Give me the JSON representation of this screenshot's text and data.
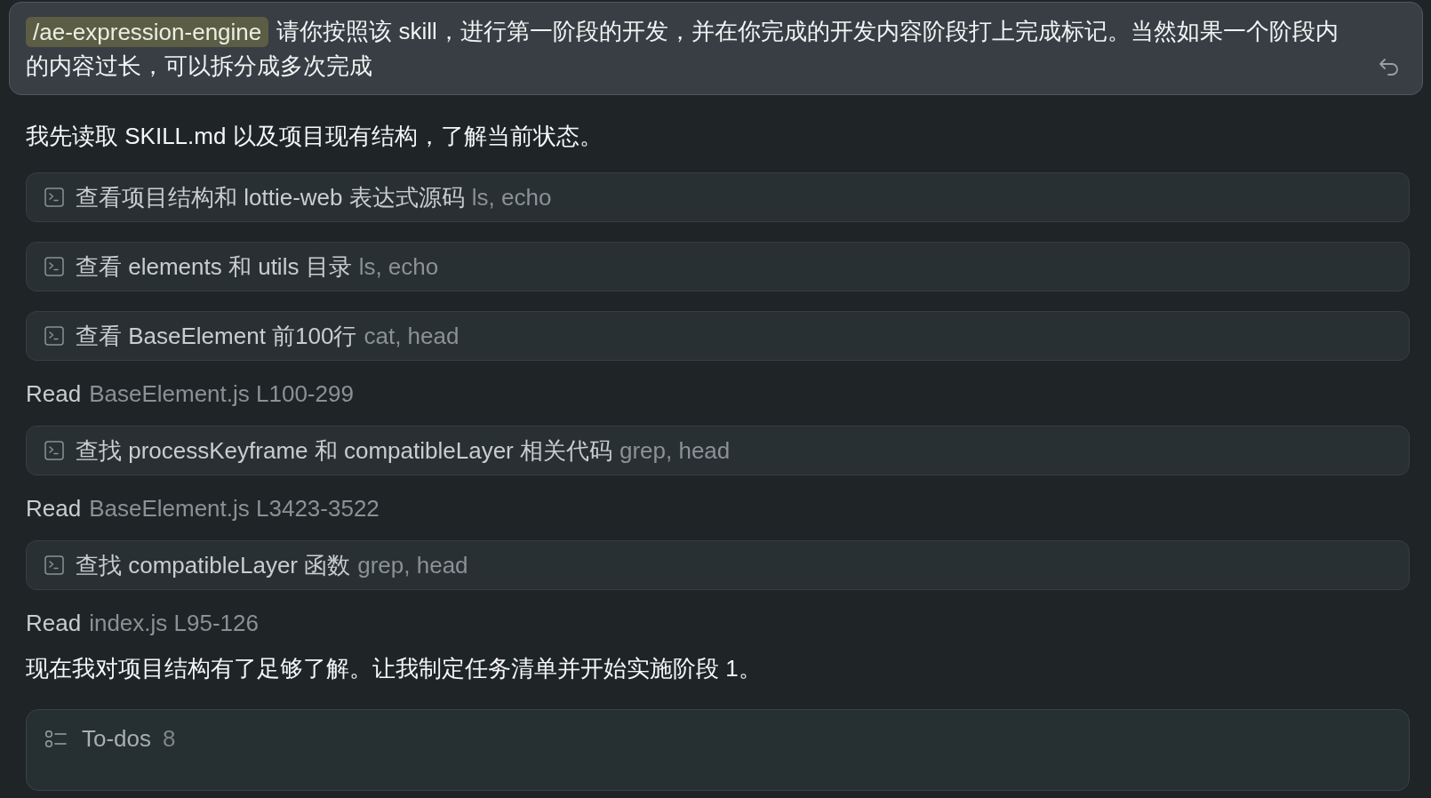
{
  "user_message": {
    "skill_tag": "/ae-expression-engine",
    "text_lines": [
      "请你按照该 skill，进行第一阶段的开发，并在你完成的开发内容阶段打上完成标记。当然如果一个阶段内",
      "的内容过长，可以拆分成多次完成"
    ]
  },
  "transcript": [
    {
      "kind": "message",
      "text": "我先读取 SKILL.md 以及项目现有结构，了解当前状态。"
    },
    {
      "kind": "command",
      "title": "查看项目结构和 lottie-web 表达式源码",
      "commands": "ls, echo"
    },
    {
      "kind": "command",
      "title": "查看 elements 和 utils 目录",
      "commands": "ls, echo"
    },
    {
      "kind": "command",
      "title": "查看 BaseElement 前100行",
      "commands": "cat, head"
    },
    {
      "kind": "read",
      "action": "Read",
      "target": "BaseElement.js L100-299"
    },
    {
      "kind": "command",
      "title": "查找 processKeyframe 和 compatibleLayer 相关代码",
      "commands": "grep, head"
    },
    {
      "kind": "read",
      "action": "Read",
      "target": "BaseElement.js L3423-3522"
    },
    {
      "kind": "command",
      "title": "查找 compatibleLayer 函数",
      "commands": "grep, head"
    },
    {
      "kind": "read",
      "action": "Read",
      "target": "index.js L95-126"
    },
    {
      "kind": "message",
      "text": "现在我对项目结构有了足够了解。让我制定任务清单并开始实施阶段 1。"
    },
    {
      "kind": "todos",
      "label": "To-dos",
      "count": "8"
    }
  ]
}
